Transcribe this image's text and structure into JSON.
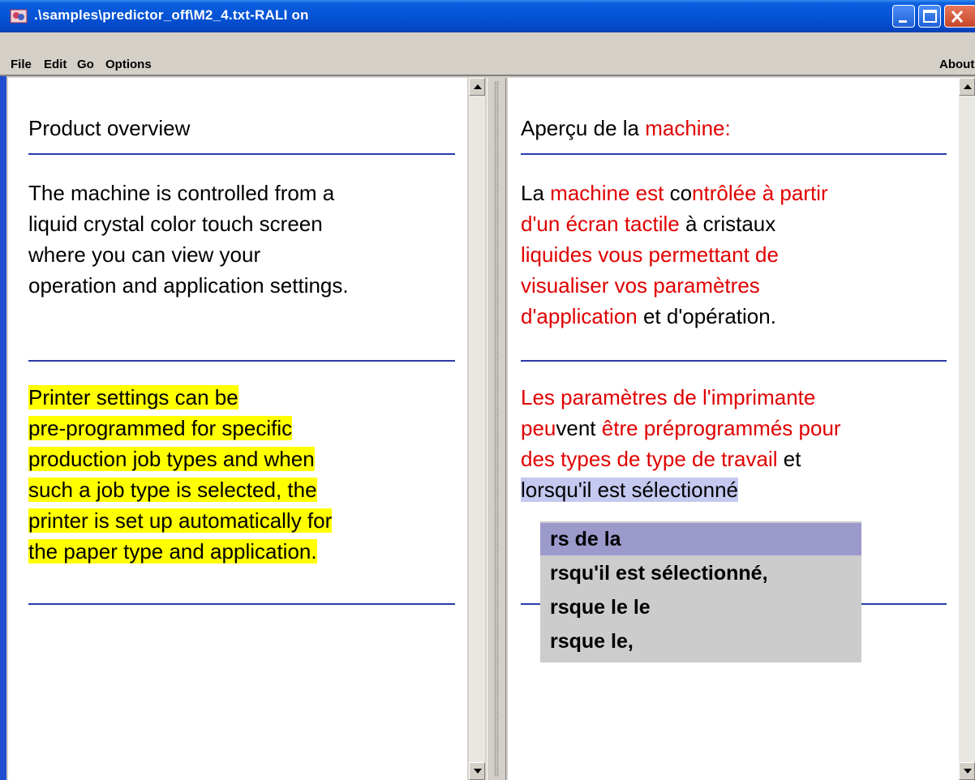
{
  "window": {
    "title": ".\\samples\\predictor_off\\M2_4.txt-RALI on"
  },
  "menu": {
    "file": "File",
    "edit": "Edit",
    "go": "Go",
    "options": "Options",
    "about": "About"
  },
  "left": {
    "heading": "Product overview",
    "para1": [
      "The machine is controlled from a",
      "liquid crystal color touch screen",
      "where you can view your",
      "operation and application settings."
    ],
    "para2": [
      "Printer settings can be",
      "pre-programmed for specific",
      "production job types and when",
      "such a job type is selected, the",
      "printer is set up automatically for",
      "the paper type and application."
    ]
  },
  "right": {
    "heading": {
      "a": "Aperçu de la ",
      "b": "machine:"
    },
    "para1": {
      "l1a": "La ",
      "l1b": "machine est",
      "l1c": " co",
      "l1d": "ntrôlée à partir",
      "l2a": "d'un écran tactile",
      "l2b": " à cristaux",
      "l3": "liquides vous permettant de",
      "l4": "visualiser vos paramètres",
      "l5a": "d'application",
      "l5b": " et d'opération."
    },
    "para2": {
      "l1": "Les paramètres de l'imprimante",
      "l2a": "peu",
      "l2b": "vent ",
      "l2c": "être préprogrammés pour",
      "l3a": "des types de type de travail",
      "l3b": " et",
      "l4a": "lo",
      "l4b": "rsqu'il est sélectionné "
    }
  },
  "autocomplete": {
    "items": [
      "rs de la",
      "rsqu'il est sélectionné,",
      "rsque le le",
      "rsque le,"
    ],
    "selected_index": 0
  },
  "colors": {
    "translated_text": "#e00000",
    "source_highlight": "#ffff00",
    "popup_selected": "#9c9acb",
    "rule_line": "#2b3aa8"
  }
}
